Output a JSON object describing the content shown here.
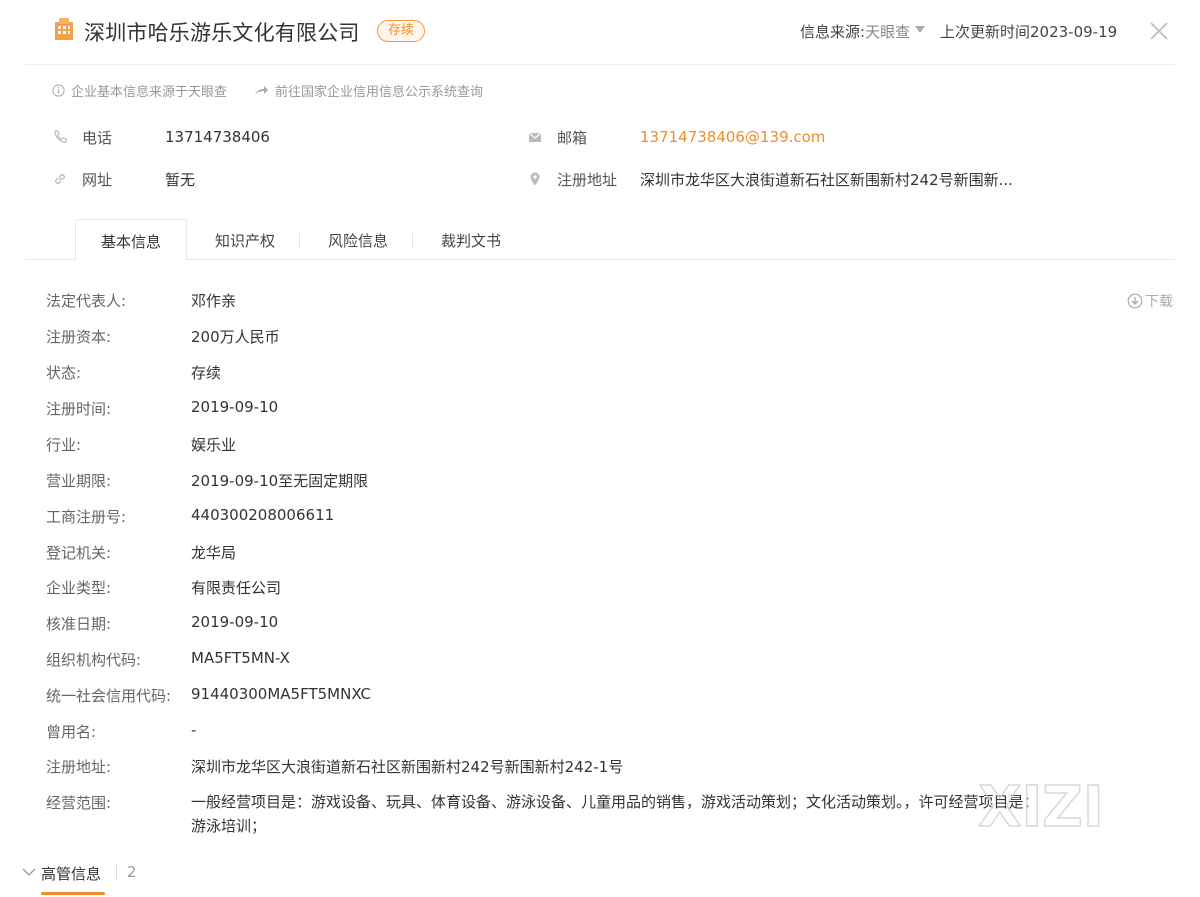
{
  "header": {
    "company_name": "深圳市哈乐游乐文化有限公司",
    "status": "存续",
    "source_label": "信息来源:",
    "source_value": "天眼查",
    "updated_text": "上次更新时间2023-09-19",
    "icons": {
      "company": "building-icon",
      "source_caret": "caret-down-icon",
      "close": "close-icon"
    },
    "colors": {
      "accent": "#f08c2a",
      "icon": "#f5a04a"
    }
  },
  "notes": [
    {
      "icon": "info-circle-icon",
      "text": "企业基本信息来源于天眼查"
    },
    {
      "icon": "forward-arrow-icon",
      "text": "前往国家企业信用信息公示系统查询"
    }
  ],
  "contacts": {
    "phone": {
      "icon": "phone-icon",
      "label": "电话",
      "value": "13714738406"
    },
    "email": {
      "icon": "mail-icon",
      "label": "邮箱",
      "value": "13714738406@139.com"
    },
    "website": {
      "icon": "link-icon",
      "label": "网址",
      "value": "暂无"
    },
    "address": {
      "icon": "location-pin-icon",
      "label": "注册地址",
      "value": "深圳市龙华区大浪街道新石社区新围新村242号新围新..."
    }
  },
  "tabs": [
    {
      "label": "基本信息",
      "active": true
    },
    {
      "label": "知识产权",
      "active": false
    },
    {
      "label": "风险信息",
      "active": false
    },
    {
      "label": "裁判文书",
      "active": false
    }
  ],
  "download": {
    "icon": "download-circle-icon",
    "label": "下载"
  },
  "info": [
    {
      "key": "法定代表人:",
      "value": "邓作亲"
    },
    {
      "key": "注册资本:",
      "value": "200万人民币"
    },
    {
      "key": "状态:",
      "value": "存续"
    },
    {
      "key": "注册时间:",
      "value": "2019-09-10"
    },
    {
      "key": "行业:",
      "value": "娱乐业"
    },
    {
      "key": "营业期限:",
      "value": "2019-09-10至无固定期限"
    },
    {
      "key": "工商注册号:",
      "value": "440300208006611"
    },
    {
      "key": "登记机关:",
      "value": "龙华局"
    },
    {
      "key": "企业类型:",
      "value": "有限责任公司"
    },
    {
      "key": "核准日期:",
      "value": "2019-09-10"
    },
    {
      "key": "组织机构代码:",
      "value": "MA5FT5MN-X"
    },
    {
      "key": "统一社会信用代码:",
      "value": "91440300MA5FT5MNXC"
    },
    {
      "key": "曾用名:",
      "value": "-"
    },
    {
      "key": "注册地址:",
      "value": "深圳市龙华区大浪街道新石社区新围新村242号新围新村242-1号"
    },
    {
      "key": "经营范围:",
      "value": "一般经营项目是：游戏设备、玩具、体育设备、游泳设备、儿童用品的销售，游戏活动策划；文化活动策划。，许可经营项目是：游泳培训；"
    }
  ],
  "watermark": {
    "text": "XIZI"
  },
  "executives": {
    "icon": "chevron-down-icon",
    "title": "高管信息",
    "count": "2"
  }
}
